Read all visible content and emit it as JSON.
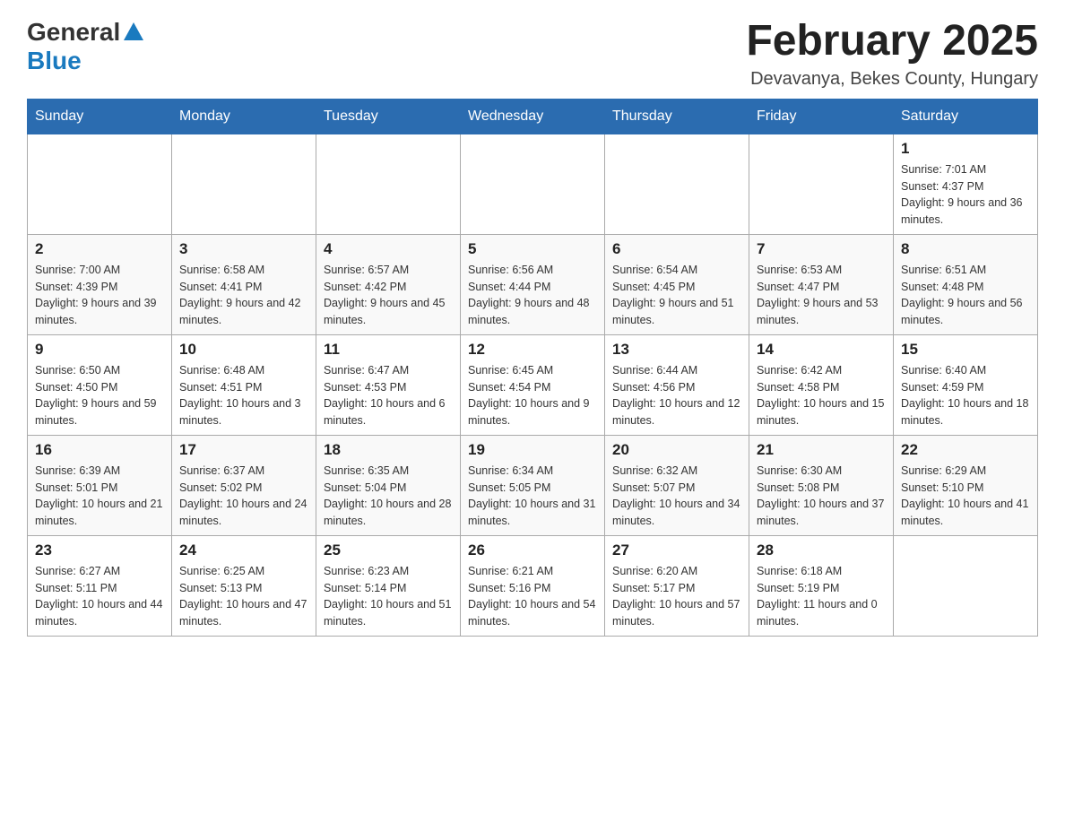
{
  "header": {
    "logo_general": "General",
    "logo_blue": "Blue",
    "month_title": "February 2025",
    "location": "Devavanya, Bekes County, Hungary"
  },
  "weekdays": [
    "Sunday",
    "Monday",
    "Tuesday",
    "Wednesday",
    "Thursday",
    "Friday",
    "Saturday"
  ],
  "weeks": [
    [
      {
        "day": "",
        "sunrise": "",
        "sunset": "",
        "daylight": ""
      },
      {
        "day": "",
        "sunrise": "",
        "sunset": "",
        "daylight": ""
      },
      {
        "day": "",
        "sunrise": "",
        "sunset": "",
        "daylight": ""
      },
      {
        "day": "",
        "sunrise": "",
        "sunset": "",
        "daylight": ""
      },
      {
        "day": "",
        "sunrise": "",
        "sunset": "",
        "daylight": ""
      },
      {
        "day": "",
        "sunrise": "",
        "sunset": "",
        "daylight": ""
      },
      {
        "day": "1",
        "sunrise": "Sunrise: 7:01 AM",
        "sunset": "Sunset: 4:37 PM",
        "daylight": "Daylight: 9 hours and 36 minutes."
      }
    ],
    [
      {
        "day": "2",
        "sunrise": "Sunrise: 7:00 AM",
        "sunset": "Sunset: 4:39 PM",
        "daylight": "Daylight: 9 hours and 39 minutes."
      },
      {
        "day": "3",
        "sunrise": "Sunrise: 6:58 AM",
        "sunset": "Sunset: 4:41 PM",
        "daylight": "Daylight: 9 hours and 42 minutes."
      },
      {
        "day": "4",
        "sunrise": "Sunrise: 6:57 AM",
        "sunset": "Sunset: 4:42 PM",
        "daylight": "Daylight: 9 hours and 45 minutes."
      },
      {
        "day": "5",
        "sunrise": "Sunrise: 6:56 AM",
        "sunset": "Sunset: 4:44 PM",
        "daylight": "Daylight: 9 hours and 48 minutes."
      },
      {
        "day": "6",
        "sunrise": "Sunrise: 6:54 AM",
        "sunset": "Sunset: 4:45 PM",
        "daylight": "Daylight: 9 hours and 51 minutes."
      },
      {
        "day": "7",
        "sunrise": "Sunrise: 6:53 AM",
        "sunset": "Sunset: 4:47 PM",
        "daylight": "Daylight: 9 hours and 53 minutes."
      },
      {
        "day": "8",
        "sunrise": "Sunrise: 6:51 AM",
        "sunset": "Sunset: 4:48 PM",
        "daylight": "Daylight: 9 hours and 56 minutes."
      }
    ],
    [
      {
        "day": "9",
        "sunrise": "Sunrise: 6:50 AM",
        "sunset": "Sunset: 4:50 PM",
        "daylight": "Daylight: 9 hours and 59 minutes."
      },
      {
        "day": "10",
        "sunrise": "Sunrise: 6:48 AM",
        "sunset": "Sunset: 4:51 PM",
        "daylight": "Daylight: 10 hours and 3 minutes."
      },
      {
        "day": "11",
        "sunrise": "Sunrise: 6:47 AM",
        "sunset": "Sunset: 4:53 PM",
        "daylight": "Daylight: 10 hours and 6 minutes."
      },
      {
        "day": "12",
        "sunrise": "Sunrise: 6:45 AM",
        "sunset": "Sunset: 4:54 PM",
        "daylight": "Daylight: 10 hours and 9 minutes."
      },
      {
        "day": "13",
        "sunrise": "Sunrise: 6:44 AM",
        "sunset": "Sunset: 4:56 PM",
        "daylight": "Daylight: 10 hours and 12 minutes."
      },
      {
        "day": "14",
        "sunrise": "Sunrise: 6:42 AM",
        "sunset": "Sunset: 4:58 PM",
        "daylight": "Daylight: 10 hours and 15 minutes."
      },
      {
        "day": "15",
        "sunrise": "Sunrise: 6:40 AM",
        "sunset": "Sunset: 4:59 PM",
        "daylight": "Daylight: 10 hours and 18 minutes."
      }
    ],
    [
      {
        "day": "16",
        "sunrise": "Sunrise: 6:39 AM",
        "sunset": "Sunset: 5:01 PM",
        "daylight": "Daylight: 10 hours and 21 minutes."
      },
      {
        "day": "17",
        "sunrise": "Sunrise: 6:37 AM",
        "sunset": "Sunset: 5:02 PM",
        "daylight": "Daylight: 10 hours and 24 minutes."
      },
      {
        "day": "18",
        "sunrise": "Sunrise: 6:35 AM",
        "sunset": "Sunset: 5:04 PM",
        "daylight": "Daylight: 10 hours and 28 minutes."
      },
      {
        "day": "19",
        "sunrise": "Sunrise: 6:34 AM",
        "sunset": "Sunset: 5:05 PM",
        "daylight": "Daylight: 10 hours and 31 minutes."
      },
      {
        "day": "20",
        "sunrise": "Sunrise: 6:32 AM",
        "sunset": "Sunset: 5:07 PM",
        "daylight": "Daylight: 10 hours and 34 minutes."
      },
      {
        "day": "21",
        "sunrise": "Sunrise: 6:30 AM",
        "sunset": "Sunset: 5:08 PM",
        "daylight": "Daylight: 10 hours and 37 minutes."
      },
      {
        "day": "22",
        "sunrise": "Sunrise: 6:29 AM",
        "sunset": "Sunset: 5:10 PM",
        "daylight": "Daylight: 10 hours and 41 minutes."
      }
    ],
    [
      {
        "day": "23",
        "sunrise": "Sunrise: 6:27 AM",
        "sunset": "Sunset: 5:11 PM",
        "daylight": "Daylight: 10 hours and 44 minutes."
      },
      {
        "day": "24",
        "sunrise": "Sunrise: 6:25 AM",
        "sunset": "Sunset: 5:13 PM",
        "daylight": "Daylight: 10 hours and 47 minutes."
      },
      {
        "day": "25",
        "sunrise": "Sunrise: 6:23 AM",
        "sunset": "Sunset: 5:14 PM",
        "daylight": "Daylight: 10 hours and 51 minutes."
      },
      {
        "day": "26",
        "sunrise": "Sunrise: 6:21 AM",
        "sunset": "Sunset: 5:16 PM",
        "daylight": "Daylight: 10 hours and 54 minutes."
      },
      {
        "day": "27",
        "sunrise": "Sunrise: 6:20 AM",
        "sunset": "Sunset: 5:17 PM",
        "daylight": "Daylight: 10 hours and 57 minutes."
      },
      {
        "day": "28",
        "sunrise": "Sunrise: 6:18 AM",
        "sunset": "Sunset: 5:19 PM",
        "daylight": "Daylight: 11 hours and 0 minutes."
      },
      {
        "day": "",
        "sunrise": "",
        "sunset": "",
        "daylight": ""
      }
    ]
  ]
}
